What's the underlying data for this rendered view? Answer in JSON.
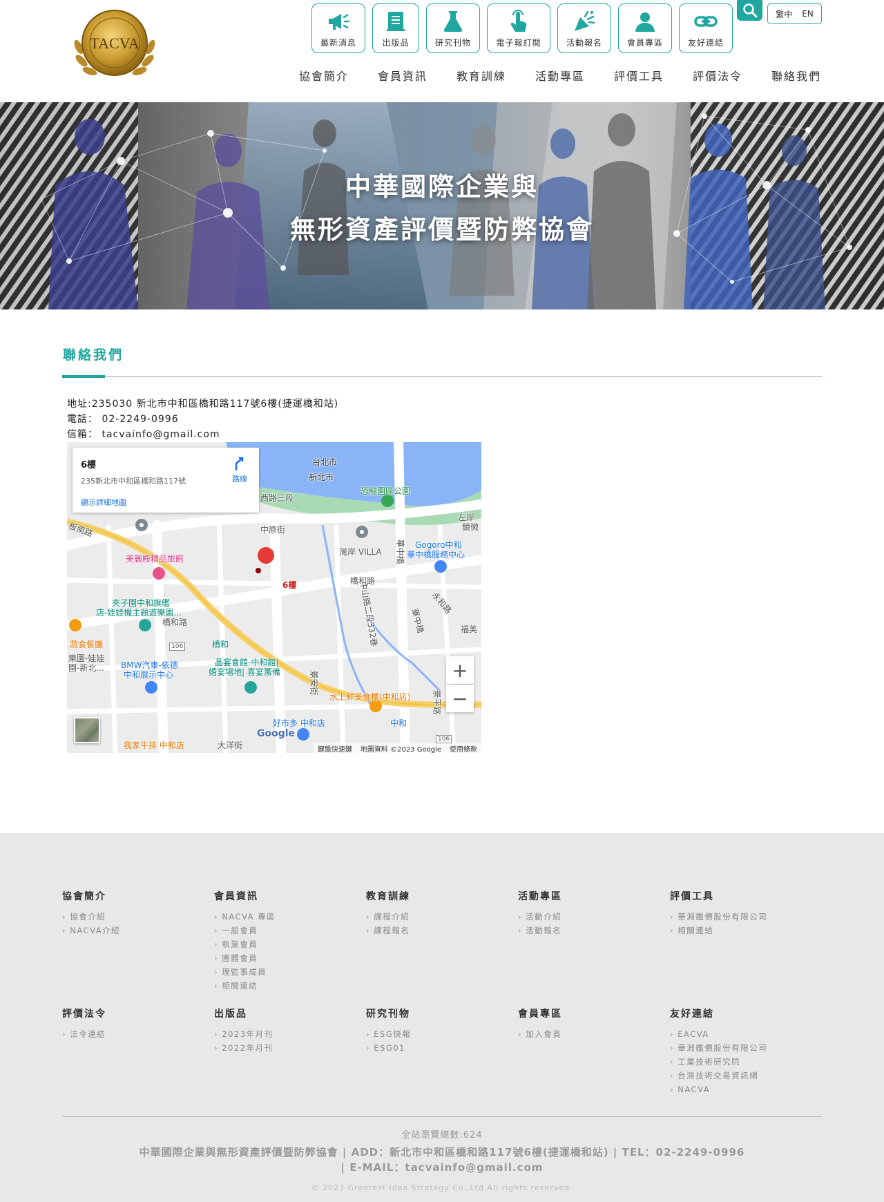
{
  "header": {
    "logo_text": "TACVA",
    "icon_nav": [
      {
        "label": "最新消息",
        "icon": "megaphone-icon"
      },
      {
        "label": "出版品",
        "icon": "book-icon"
      },
      {
        "label": "研究刊物",
        "icon": "flask-icon"
      },
      {
        "label": "電子報訂閱",
        "icon": "tap-hand-icon"
      },
      {
        "label": "活動報名",
        "icon": "party-icon"
      },
      {
        "label": "會員專區",
        "icon": "user-icon"
      },
      {
        "label": "友好連結",
        "icon": "link-icon"
      }
    ],
    "lang": [
      "繁中",
      "EN"
    ],
    "main_nav": [
      "協會簡介",
      "會員資訊",
      "教育訓練",
      "活動專區",
      "評價工具",
      "評價法令",
      "聯絡我們"
    ]
  },
  "banner": {
    "title_line1": "中華國際企業與",
    "title_line2": "無形資產評價暨防弊協會"
  },
  "content": {
    "heading": "聯絡我們",
    "address": "地址:235030 新北市中和區橋和路117號6樓(捷運橋和站)",
    "phone": "電話： 02-2249-0996",
    "email": "信箱： tacvainfo@gmail.com"
  },
  "map": {
    "card_title": "6樓",
    "card_address": "235新北市中和區橋和路117號",
    "card_link": "顯示詳細地圖",
    "directions": "路線",
    "marker_label": "6樓",
    "attribution": [
      "鍵盤快速鍵",
      "地圖資料 ©2023 Google",
      "使用條款"
    ],
    "google": "Google",
    "labels": {
      "taipei": "台北市",
      "new_taipei": "新北市",
      "dino_park": "恐龍園區公園",
      "west_rd": "西路三段",
      "zhongyuan": "中原街",
      "villa": "灣岸 VILLA",
      "gogoro": "Gogoro中和",
      "gogoro2": "華中橋服務中心",
      "zuoan": "左岸",
      "jingwei": "鏡微",
      "hotel": "美麗殿精品旅館",
      "jiazi1": "夾子園中和旗艦",
      "jiazi2": "店-娃娃機主題遊樂園...",
      "qiaohe_rd": "橋和路",
      "qiaohe_rd2": "橋和路",
      "qiaohe_station": "橋和",
      "zhongshan": "中山路二段332巷",
      "huazhong": "華中橋",
      "huazhong2": "華中橋",
      "yonghe": "永和路",
      "fumei": "福美",
      "veg": "蔬食餐廳",
      "bmw1": "BMW汽車-依德",
      "bmw2": "中和展示中心",
      "amusement1": "樂園-娃娃",
      "amusement2": "園-新北...",
      "jingyan1": "晶宴會館-中和館|",
      "jingyan2": "婚宴場地| 喜宴籌備",
      "seafood": "水上鮮美食樓(中和店)",
      "costco": "好市多 中和店",
      "zhonghe": "中和",
      "steak": "我家牛排 中和店",
      "dayang": "大洋街",
      "jing_an": "景安街",
      "jingping": "景平路",
      "banan": "板南路",
      "hwy106": "106",
      "hwy106b": "106"
    }
  },
  "footer": {
    "columns": [
      {
        "title": "協會簡介",
        "items": [
          "協會介紹",
          "NACVA介紹"
        ]
      },
      {
        "title": "會員資訊",
        "items": [
          "NACVA 專區",
          "一般會員",
          "執業會員",
          "團體會員",
          "理監事成員",
          "相關連結"
        ]
      },
      {
        "title": "教育訓練",
        "items": [
          "課程介紹",
          "課程報名"
        ]
      },
      {
        "title": "活動專區",
        "items": [
          "活動介紹",
          "活動報名"
        ]
      },
      {
        "title": "評價工具",
        "items": [
          "華淵鑑價股份有限公司",
          "相關連結"
        ]
      },
      {
        "title": "評價法令",
        "items": [
          "法令連結"
        ]
      },
      {
        "title": "出版品",
        "items": [
          "2023年月刊",
          "2022年月刊"
        ]
      },
      {
        "title": "研究刊物",
        "items": [
          "ESG快報",
          "ESG01"
        ]
      },
      {
        "title": "會員專區",
        "items": [
          "加入會員"
        ]
      },
      {
        "title": "友好連結",
        "items": [
          "EACVA",
          "華淵鑑價股份有限公司",
          "工業技術研究院",
          "台灣技術交易資訊網",
          "NACVA"
        ]
      }
    ],
    "visits": "全站瀏覽總數:624",
    "info_line1": "中華國際企業與無形資產評價暨防弊協會 | ADD：新北市中和區橋和路117號6樓(捷運橋和站) | TEL：02-2249-0996",
    "info_line2": "| E-MAIL：tacvainfo@gmail.com",
    "copyright": "© 2023 Greatest Idea Strategy Co.,Ltd All rights reserved."
  },
  "colors": {
    "accent": "#1fa7a0",
    "footer_bg": "#e8e8e8",
    "heading": "#1fa7a0"
  }
}
